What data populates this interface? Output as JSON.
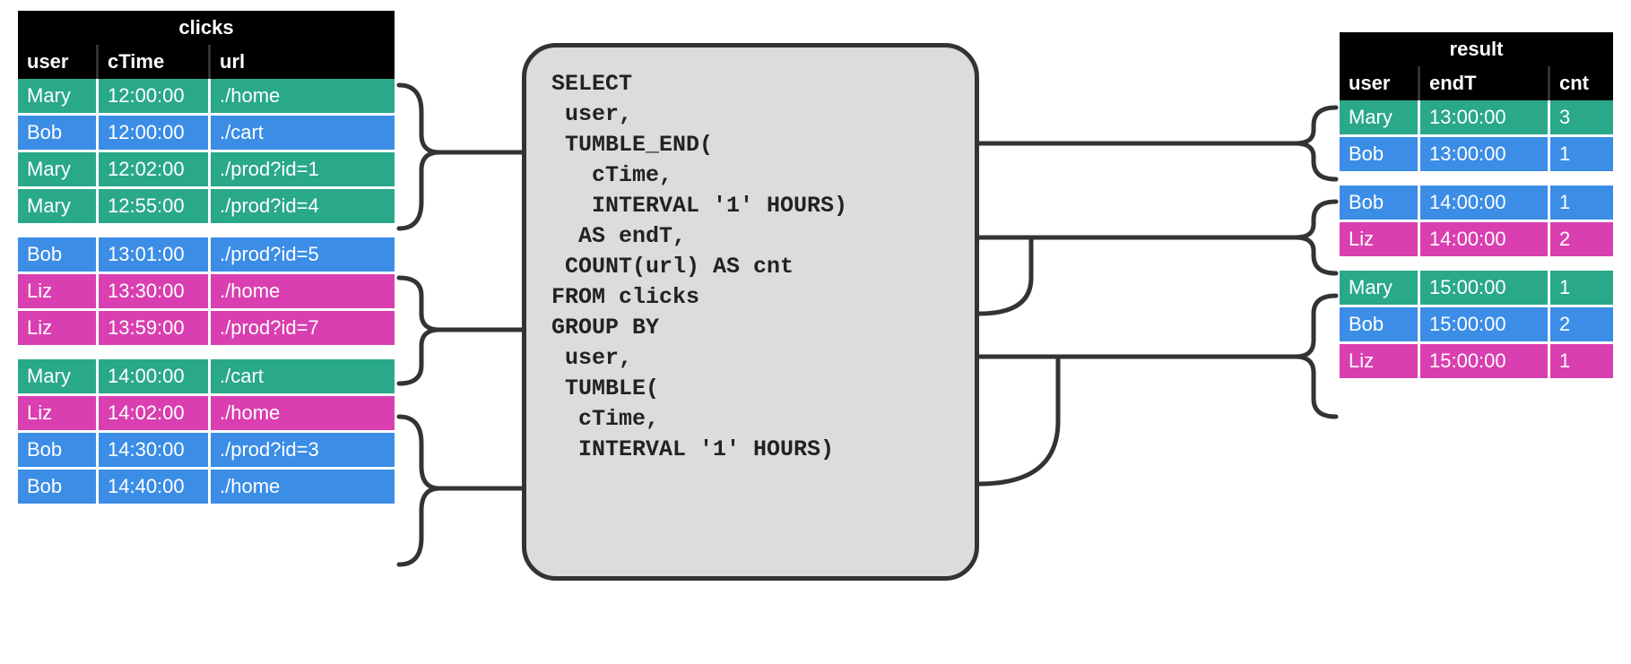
{
  "users": {
    "Mary": "mary",
    "Bob": "bob",
    "Liz": "liz"
  },
  "clicks": {
    "title": "clicks",
    "columns": [
      "user",
      "cTime",
      "url"
    ],
    "groups": [
      [
        {
          "user": "Mary",
          "cTime": "12:00:00",
          "url": "./home"
        },
        {
          "user": "Bob",
          "cTime": "12:00:00",
          "url": "./cart"
        },
        {
          "user": "Mary",
          "cTime": "12:02:00",
          "url": "./prod?id=1"
        },
        {
          "user": "Mary",
          "cTime": "12:55:00",
          "url": "./prod?id=4"
        }
      ],
      [
        {
          "user": "Bob",
          "cTime": "13:01:00",
          "url": "./prod?id=5"
        },
        {
          "user": "Liz",
          "cTime": "13:30:00",
          "url": "./home"
        },
        {
          "user": "Liz",
          "cTime": "13:59:00",
          "url": "./prod?id=7"
        }
      ],
      [
        {
          "user": "Mary",
          "cTime": "14:00:00",
          "url": "./cart"
        },
        {
          "user": "Liz",
          "cTime": "14:02:00",
          "url": "./home"
        },
        {
          "user": "Bob",
          "cTime": "14:30:00",
          "url": "./prod?id=3"
        },
        {
          "user": "Bob",
          "cTime": "14:40:00",
          "url": "./home"
        }
      ]
    ]
  },
  "result": {
    "title": "result",
    "columns": [
      "user",
      "endT",
      "cnt"
    ],
    "groups": [
      [
        {
          "user": "Mary",
          "endT": "13:00:00",
          "cnt": "3"
        },
        {
          "user": "Bob",
          "endT": "13:00:00",
          "cnt": "1"
        }
      ],
      [
        {
          "user": "Bob",
          "endT": "14:00:00",
          "cnt": "1"
        },
        {
          "user": "Liz",
          "endT": "14:00:00",
          "cnt": "2"
        }
      ],
      [
        {
          "user": "Mary",
          "endT": "15:00:00",
          "cnt": "1"
        },
        {
          "user": "Bob",
          "endT": "15:00:00",
          "cnt": "2"
        },
        {
          "user": "Liz",
          "endT": "15:00:00",
          "cnt": "1"
        }
      ]
    ]
  },
  "sql": "SELECT\n user,\n TUMBLE_END(\n   cTime,\n   INTERVAL '1' HOURS)\n  AS endT,\n COUNT(url) AS cnt\nFROM clicks\nGROUP BY\n user,\n TUMBLE(\n  cTime,\n  INTERVAL '1' HOURS)"
}
